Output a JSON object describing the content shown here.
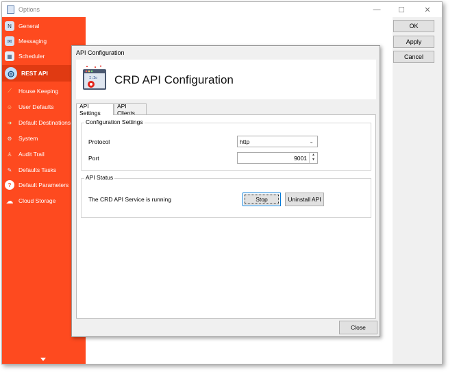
{
  "window": {
    "title": "Options",
    "minimize": "—",
    "maximize": "☐",
    "close": "✕"
  },
  "sidebar": {
    "items": [
      {
        "label": "General",
        "icon": "general-icon",
        "glyph": "N"
      },
      {
        "label": "Messaging",
        "icon": "messaging-icon",
        "glyph": "✉"
      },
      {
        "label": "Scheduler",
        "icon": "scheduler-icon",
        "glyph": "▦"
      },
      {
        "label": "REST API",
        "icon": "globe-icon",
        "glyph": "◎"
      },
      {
        "label": "House Keeping",
        "icon": "broom-icon",
        "glyph": "⟋"
      },
      {
        "label": "User Defaults",
        "icon": "users-icon",
        "glyph": "☺"
      },
      {
        "label": "Default Destinations",
        "icon": "destinations-icon",
        "glyph": "➜"
      },
      {
        "label": "System",
        "icon": "system-icon",
        "glyph": "⚙"
      },
      {
        "label": "Audit Trail",
        "icon": "audit-icon",
        "glyph": "♙"
      },
      {
        "label": "Defaults Tasks",
        "icon": "wrench-icon",
        "glyph": "✎"
      },
      {
        "label": "Default Parameters",
        "icon": "help-icon",
        "glyph": "?"
      },
      {
        "label": "Cloud Storage",
        "icon": "cloud-icon",
        "glyph": "☁"
      }
    ],
    "selected": "REST API"
  },
  "actions": {
    "ok": "OK",
    "apply": "Apply",
    "cancel": "Cancel"
  },
  "dialog": {
    "title": "API Configuration",
    "heading": "CRD API Configuration",
    "tabs": [
      "API Settings",
      "API Clients"
    ],
    "config_group": "Configuration Settings",
    "protocol_label": "Protocol",
    "protocol_value": "http",
    "port_label": "Port",
    "port_value": "9001",
    "status_group": "API Status",
    "status_text": "The CRD API Service is running",
    "stop_button": "Stop",
    "uninstall_button": "Uninstall API",
    "close_button": "Close"
  },
  "colors": {
    "sidebar": "#fe4a1f",
    "sidebar_selected": "#e03a12"
  }
}
